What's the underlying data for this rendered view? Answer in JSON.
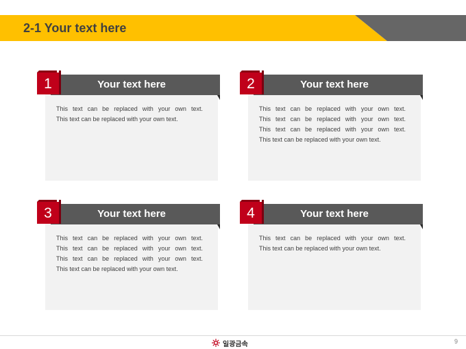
{
  "header": {
    "title": "2-1 Your text here"
  },
  "cards": [
    {
      "number": "1",
      "title": "Your text here",
      "lines": [
        "This text can be replaced with your own text.",
        "This text can be replaced with your own text."
      ]
    },
    {
      "number": "2",
      "title": "Your text here",
      "lines": [
        "This text can be replaced with your own text.",
        "This text can be replaced with your own text.",
        "This text can be replaced with your own text.",
        "This text can be replaced with your own text."
      ]
    },
    {
      "number": "3",
      "title": "Your text here",
      "lines": [
        "This text can be replaced with your own text.",
        "This text can be replaced with your own text.",
        "This text can be replaced with your own text.",
        "This text can be replaced with your own text."
      ]
    },
    {
      "number": "4",
      "title": "Your text here",
      "lines": [
        "This text can be replaced with your own text.",
        "This text can be replaced with your own text."
      ]
    }
  ],
  "footer": {
    "logo_text": "일광금속",
    "page_number": "9"
  },
  "colors": {
    "accent_yellow": "#FFC000",
    "header_gray": "#595959",
    "number_red": "#C0001A",
    "card_bg": "#F2F2F2"
  }
}
